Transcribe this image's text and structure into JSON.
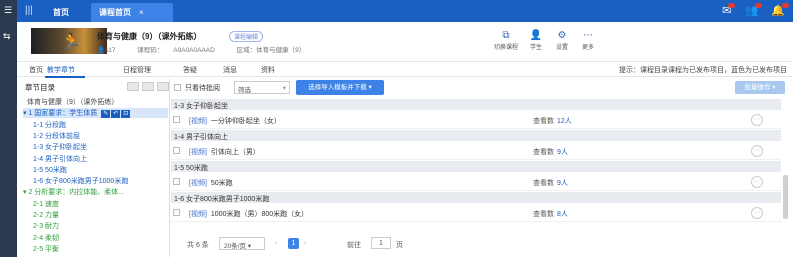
{
  "rail": {
    "toggle_icon": "grid-icon",
    "swap_icon": "swap-icon"
  },
  "topbar": {
    "tabs": [
      {
        "label": "首页"
      },
      {
        "label": "课程首页",
        "close": "×"
      }
    ],
    "icons": [
      "mail-icon",
      "user-add-icon",
      "notification-icon"
    ]
  },
  "course": {
    "name": "体育与健康（9）（课外拓练）",
    "tag": "课程编辑",
    "stats": {
      "count": "117",
      "code_label": "课程码：",
      "code": "A9A0A0AAAD",
      "school": "区域：体育与健康（9）"
    },
    "actions": [
      {
        "label": "切换课程",
        "icon": "switch-icon"
      },
      {
        "label": "学生",
        "icon": "student-icon"
      },
      {
        "label": "设置",
        "icon": "settings-icon"
      },
      {
        "label": "更多",
        "icon": "more-icon"
      }
    ]
  },
  "subnav": {
    "items": [
      "首页",
      "教学章节",
      "日程管理",
      "答疑",
      "消息",
      "资料"
    ],
    "active_index": 1,
    "hint": "提示：课程目录课程为已发布项目，蓝色为已发布项目"
  },
  "tree": {
    "header": "章节目录",
    "nodes": [
      {
        "label": "体育与健康（9）（课外拓练）",
        "kind": "root",
        "indent": 0
      },
      {
        "label": "1 国家要求：学生体质",
        "kind": "sel",
        "indent": 1,
        "tools": [
          "✎",
          "↶",
          "⊡"
        ]
      },
      {
        "label": "1-1 分段跑",
        "kind": "blue",
        "indent": 2
      },
      {
        "label": "1-2 分段体前屈",
        "kind": "blue",
        "indent": 2
      },
      {
        "label": "1-3 女子仰卧起坐",
        "kind": "blue",
        "indent": 2
      },
      {
        "label": "1-4 男子引体向上",
        "kind": "blue",
        "indent": 2
      },
      {
        "label": "1-5 50米跑",
        "kind": "blue",
        "indent": 2
      },
      {
        "label": "1-6 女子800米跑男子1000米跑",
        "kind": "blue",
        "indent": 2
      },
      {
        "label": "2 分析要求：内拉体能、柔体...",
        "kind": "green",
        "indent": 1
      },
      {
        "label": "2-1 速度",
        "kind": "green",
        "indent": 2
      },
      {
        "label": "2-2 力量",
        "kind": "green",
        "indent": 2
      },
      {
        "label": "2-3 耐力",
        "kind": "green",
        "indent": 2
      },
      {
        "label": "2-4 柔韧",
        "kind": "green",
        "indent": 2
      },
      {
        "label": "2-5 平衡",
        "kind": "green",
        "indent": 2
      }
    ]
  },
  "list": {
    "filter": {
      "only_label": "只看待批阅",
      "select_value": "筛选",
      "batch_button": "选择导入模板并下载",
      "action_button": "批量操作"
    },
    "groups": [
      {
        "title": "1-3 女子仰卧起坐",
        "items": [
          {
            "tag": "[视频]",
            "title": "一分钟仰卧起坐（女）",
            "stat_label": "查看数",
            "stat": "12人"
          }
        ]
      },
      {
        "title": "1-4 男子引体向上",
        "items": [
          {
            "tag": "[视频]",
            "title": "引体向上（男）",
            "stat_label": "查看数",
            "stat": "9人"
          }
        ]
      },
      {
        "title": "1-5 50米跑",
        "items": [
          {
            "tag": "[视频]",
            "title": "50米跑",
            "stat_label": "查看数",
            "stat": "9人"
          }
        ]
      },
      {
        "title": "1-6 女子800米跑男子1000米跑",
        "items": [
          {
            "tag": "[视频]",
            "title": "1000米跑（男）800米跑（女）",
            "stat_label": "查看数",
            "stat": "8人"
          }
        ]
      }
    ],
    "op_icon": "op-icon",
    "pager": {
      "total": "共 6 条",
      "page_size": "20条/页",
      "current": "1",
      "goto_label": "前往",
      "goto_value": "1",
      "page_unit": "页"
    }
  }
}
